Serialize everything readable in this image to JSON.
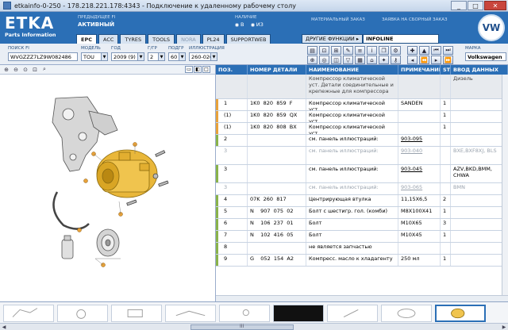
{
  "window": {
    "title": "etkainfo-0-250 - 178.218.221.178:4343 - Подключение к удаленному рабочему столу",
    "buttons": [
      "_",
      "□",
      "✕"
    ]
  },
  "header": {
    "logo_text": "ETKA",
    "logo_sub": "Parts Information",
    "prev_label": "ПРЕДЫДУЩЕЕ FI",
    "prev_value": "АКТИВНЫЙ",
    "avail_label": "НАЛИЧИЕ",
    "avail_opt1": "В",
    "avail_opt2": "ИЗ",
    "order_label": "МАТЕРИАЛЬНЫЙ ЗАКАЗ",
    "combined_label": "ЗАЯВКА НА СБОРНЫЙ ЗАКАЗ",
    "tabs": [
      "EPC",
      "ACC",
      "TYRES",
      "TOOLS",
      "NORA",
      "PL24",
      "SUPPORTWEB"
    ],
    "func_label": "ДРУГИЕ ФУНКЦИИ ▸",
    "func_value": "INFOLINE",
    "brand_logo": "VW"
  },
  "filters": {
    "fi_label": "ПОИСК FI",
    "fi_value": "WVGZZZ7LZ9W082486",
    "model_label": "МОДЕЛЬ",
    "model_value": "TOU",
    "year_label": "ГОД",
    "year_value": "2009 (9)",
    "group_label": "Г/ГР",
    "group_value": "2",
    "subgroup_label": "ПОДГР",
    "subgroup_value": "60",
    "illus_label": "ИЛЛЮСТРАЦИЯ",
    "illus_value": "260-020",
    "brand_label": "МАРКА",
    "brand_value": "Volkswagen"
  },
  "left_toolbar_icons": [
    "zoom-in-icon",
    "zoom-out-icon",
    "zoom-fit-icon",
    "zoom-area-icon",
    "search-icon"
  ],
  "table": {
    "columns": [
      "ПОЗ.",
      "НОМЕР ДЕТАЛИ",
      "НАИМЕНОВАНИЕ",
      "ПРИМЕЧАНИЕ",
      "ST",
      "ВВОД ДАННЫХ"
    ],
    "info_row": {
      "name": "Компрессор климатической уст. Детали соединительные и крепежные для компрессора",
      "extra": "Дизель"
    },
    "rows": [
      {
        "pos": "1",
        "num": "1K0  820  859  F",
        "name": "Компрессор климатической уст.",
        "note": "SANDEN",
        "st": "1",
        "input": "",
        "mark": "#e8a23a",
        "grey": false,
        "ul": false
      },
      {
        "pos": "(1)",
        "num": "1K0  820  859  QX",
        "name": "Компрессор климатической уст.",
        "note": "",
        "st": "1",
        "input": "",
        "mark": "#e8a23a",
        "grey": false,
        "ul": false
      },
      {
        "pos": "(1)",
        "num": "1K0  820  808  BX",
        "name": "Компрессор климатической уст.",
        "note": "",
        "st": "1",
        "input": "",
        "mark": "#e8a23a",
        "grey": false,
        "ul": false
      },
      {
        "pos": "2",
        "num": "",
        "name": "см. панель иллюстраций:",
        "note": "903-095",
        "st": "",
        "input": "",
        "mark": "#8ab34a",
        "grey": false,
        "ul": true
      },
      {
        "pos": "3",
        "num": "",
        "name": "см. панель иллюстраций:",
        "note": "903-040",
        "st": "",
        "input": "BXE,BXF8XJ, BLS",
        "mark": "",
        "grey": true,
        "ul": true
      },
      {
        "pos": "3",
        "num": "",
        "name": "см. панель иллюстраций:",
        "note": "903-045",
        "st": "",
        "input": "AZV,BKD,BMM, CHWA",
        "mark": "#8ab34a",
        "grey": false,
        "ul": true
      },
      {
        "pos": "3",
        "num": "",
        "name": "см. панель иллюстраций:",
        "note": "903-065",
        "st": "",
        "input": "BMN",
        "mark": "",
        "grey": true,
        "ul": true
      },
      {
        "pos": "4",
        "num": "07K  260  817",
        "name": "Центрирующая втулка",
        "note": "11,15X6,5",
        "st": "2",
        "input": "",
        "mark": "#8ab34a",
        "grey": false,
        "ul": false
      },
      {
        "pos": "5",
        "num": "N    907  075  02",
        "name": "Болт с шестигр. гол. (комби)",
        "note": "M8X100X41",
        "st": "1",
        "input": "",
        "mark": "#8ab34a",
        "grey": false,
        "ul": false
      },
      {
        "pos": "6",
        "num": "N    106  237  01",
        "name": "Болт",
        "note": "M10X65",
        "st": "3",
        "input": "",
        "mark": "#8ab34a",
        "grey": false,
        "ul": false
      },
      {
        "pos": "7",
        "num": "N    102  416  05",
        "name": "Болт",
        "note": "M10X45",
        "st": "1",
        "input": "",
        "mark": "#8ab34a",
        "grey": false,
        "ul": false
      },
      {
        "pos": "8",
        "num": "",
        "name": "не является запчастью",
        "note": "",
        "st": "",
        "input": "",
        "mark": "#8ab34a",
        "grey": false,
        "ul": false
      },
      {
        "pos": "9",
        "num": "G    052  154  A2",
        "name": "Компресс. масло к хладагенту",
        "note": "250 мл",
        "st": "1",
        "input": "",
        "mark": "#8ab34a",
        "grey": false,
        "ul": false
      }
    ]
  },
  "strip": {
    "scroll_mark": "III"
  },
  "colors": {
    "brand_blue": "#2b6fb6",
    "orange_mark": "#e8a23a",
    "green_mark": "#8ab34a",
    "compressor": "#e9b73a"
  }
}
